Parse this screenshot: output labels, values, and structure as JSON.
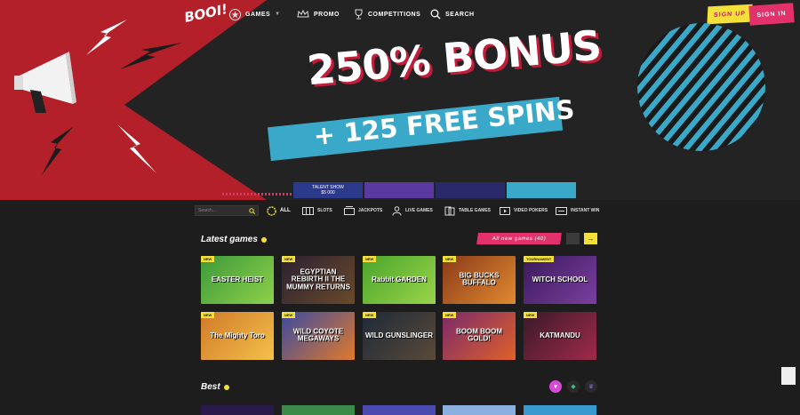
{
  "logo_text": "BOOI!",
  "nav": {
    "games": "GAMES",
    "promo": "PROMO",
    "competitions": "COMPETITIONS",
    "search": "SEARCH",
    "sign_up": "SIGN UP",
    "sign_in": "SIGN IN"
  },
  "hero": {
    "headline": "250% BONUS",
    "subline": "+ 125 FREE SPINS",
    "strip_text_1": "TALENT SHOW",
    "strip_text_2": "$5 000"
  },
  "filter": {
    "search_placeholder": "Search...",
    "categories": [
      "ALL",
      "SLOTS",
      "JACKPOTS",
      "LIVE GAMES",
      "TABLE GAMES",
      "VIDEO POKERS",
      "INSTANT WIN"
    ]
  },
  "latest": {
    "title": "Latest games",
    "all_new_label": "All new games (40)",
    "games": [
      {
        "title": "EASTER HEIST",
        "badge": "NEW",
        "color1": "#3d9a3a",
        "color2": "#8ed04a"
      },
      {
        "title": "EGYPTIAN REBIRTH II THE MUMMY RETURNS",
        "badge": "NEW",
        "color1": "#2b2033",
        "color2": "#6a4a2a"
      },
      {
        "title": "Rabbit GARDEN",
        "badge": "NEW",
        "color1": "#4aa52c",
        "color2": "#9ad44a"
      },
      {
        "title": "BIG BUCKS BUFFALO",
        "badge": "NEW",
        "color1": "#8a3a1a",
        "color2": "#e08a30"
      },
      {
        "title": "WITCH SCHOOL",
        "badge": "TOURNAMENT",
        "color1": "#3b1a5a",
        "color2": "#7a3fa0"
      },
      {
        "title": "The Mighty Toro",
        "badge": "NEW",
        "color1": "#d07a2a",
        "color2": "#f4c04a"
      },
      {
        "title": "WILD COYOTE MEGAWAYS",
        "badge": "NEW",
        "color1": "#3a4aa0",
        "color2": "#e07a2a"
      },
      {
        "title": "WILD GUNSLINGER",
        "badge": "NEW",
        "color1": "#1e2a38",
        "color2": "#5a4a3a"
      },
      {
        "title": "BOOM BOOM GOLD!",
        "badge": "NEW",
        "color1": "#7a2a6a",
        "color2": "#e0602a"
      },
      {
        "title": "KATMANDU",
        "badge": "NEW",
        "color1": "#3a1a2a",
        "color2": "#a02a4a"
      }
    ]
  },
  "best": {
    "title": "Best"
  },
  "colors": {
    "accent_pink": "#e3316c",
    "accent_yellow": "#f4e03a",
    "accent_blue": "#3aa9c9",
    "hero_red": "#b3202a"
  }
}
